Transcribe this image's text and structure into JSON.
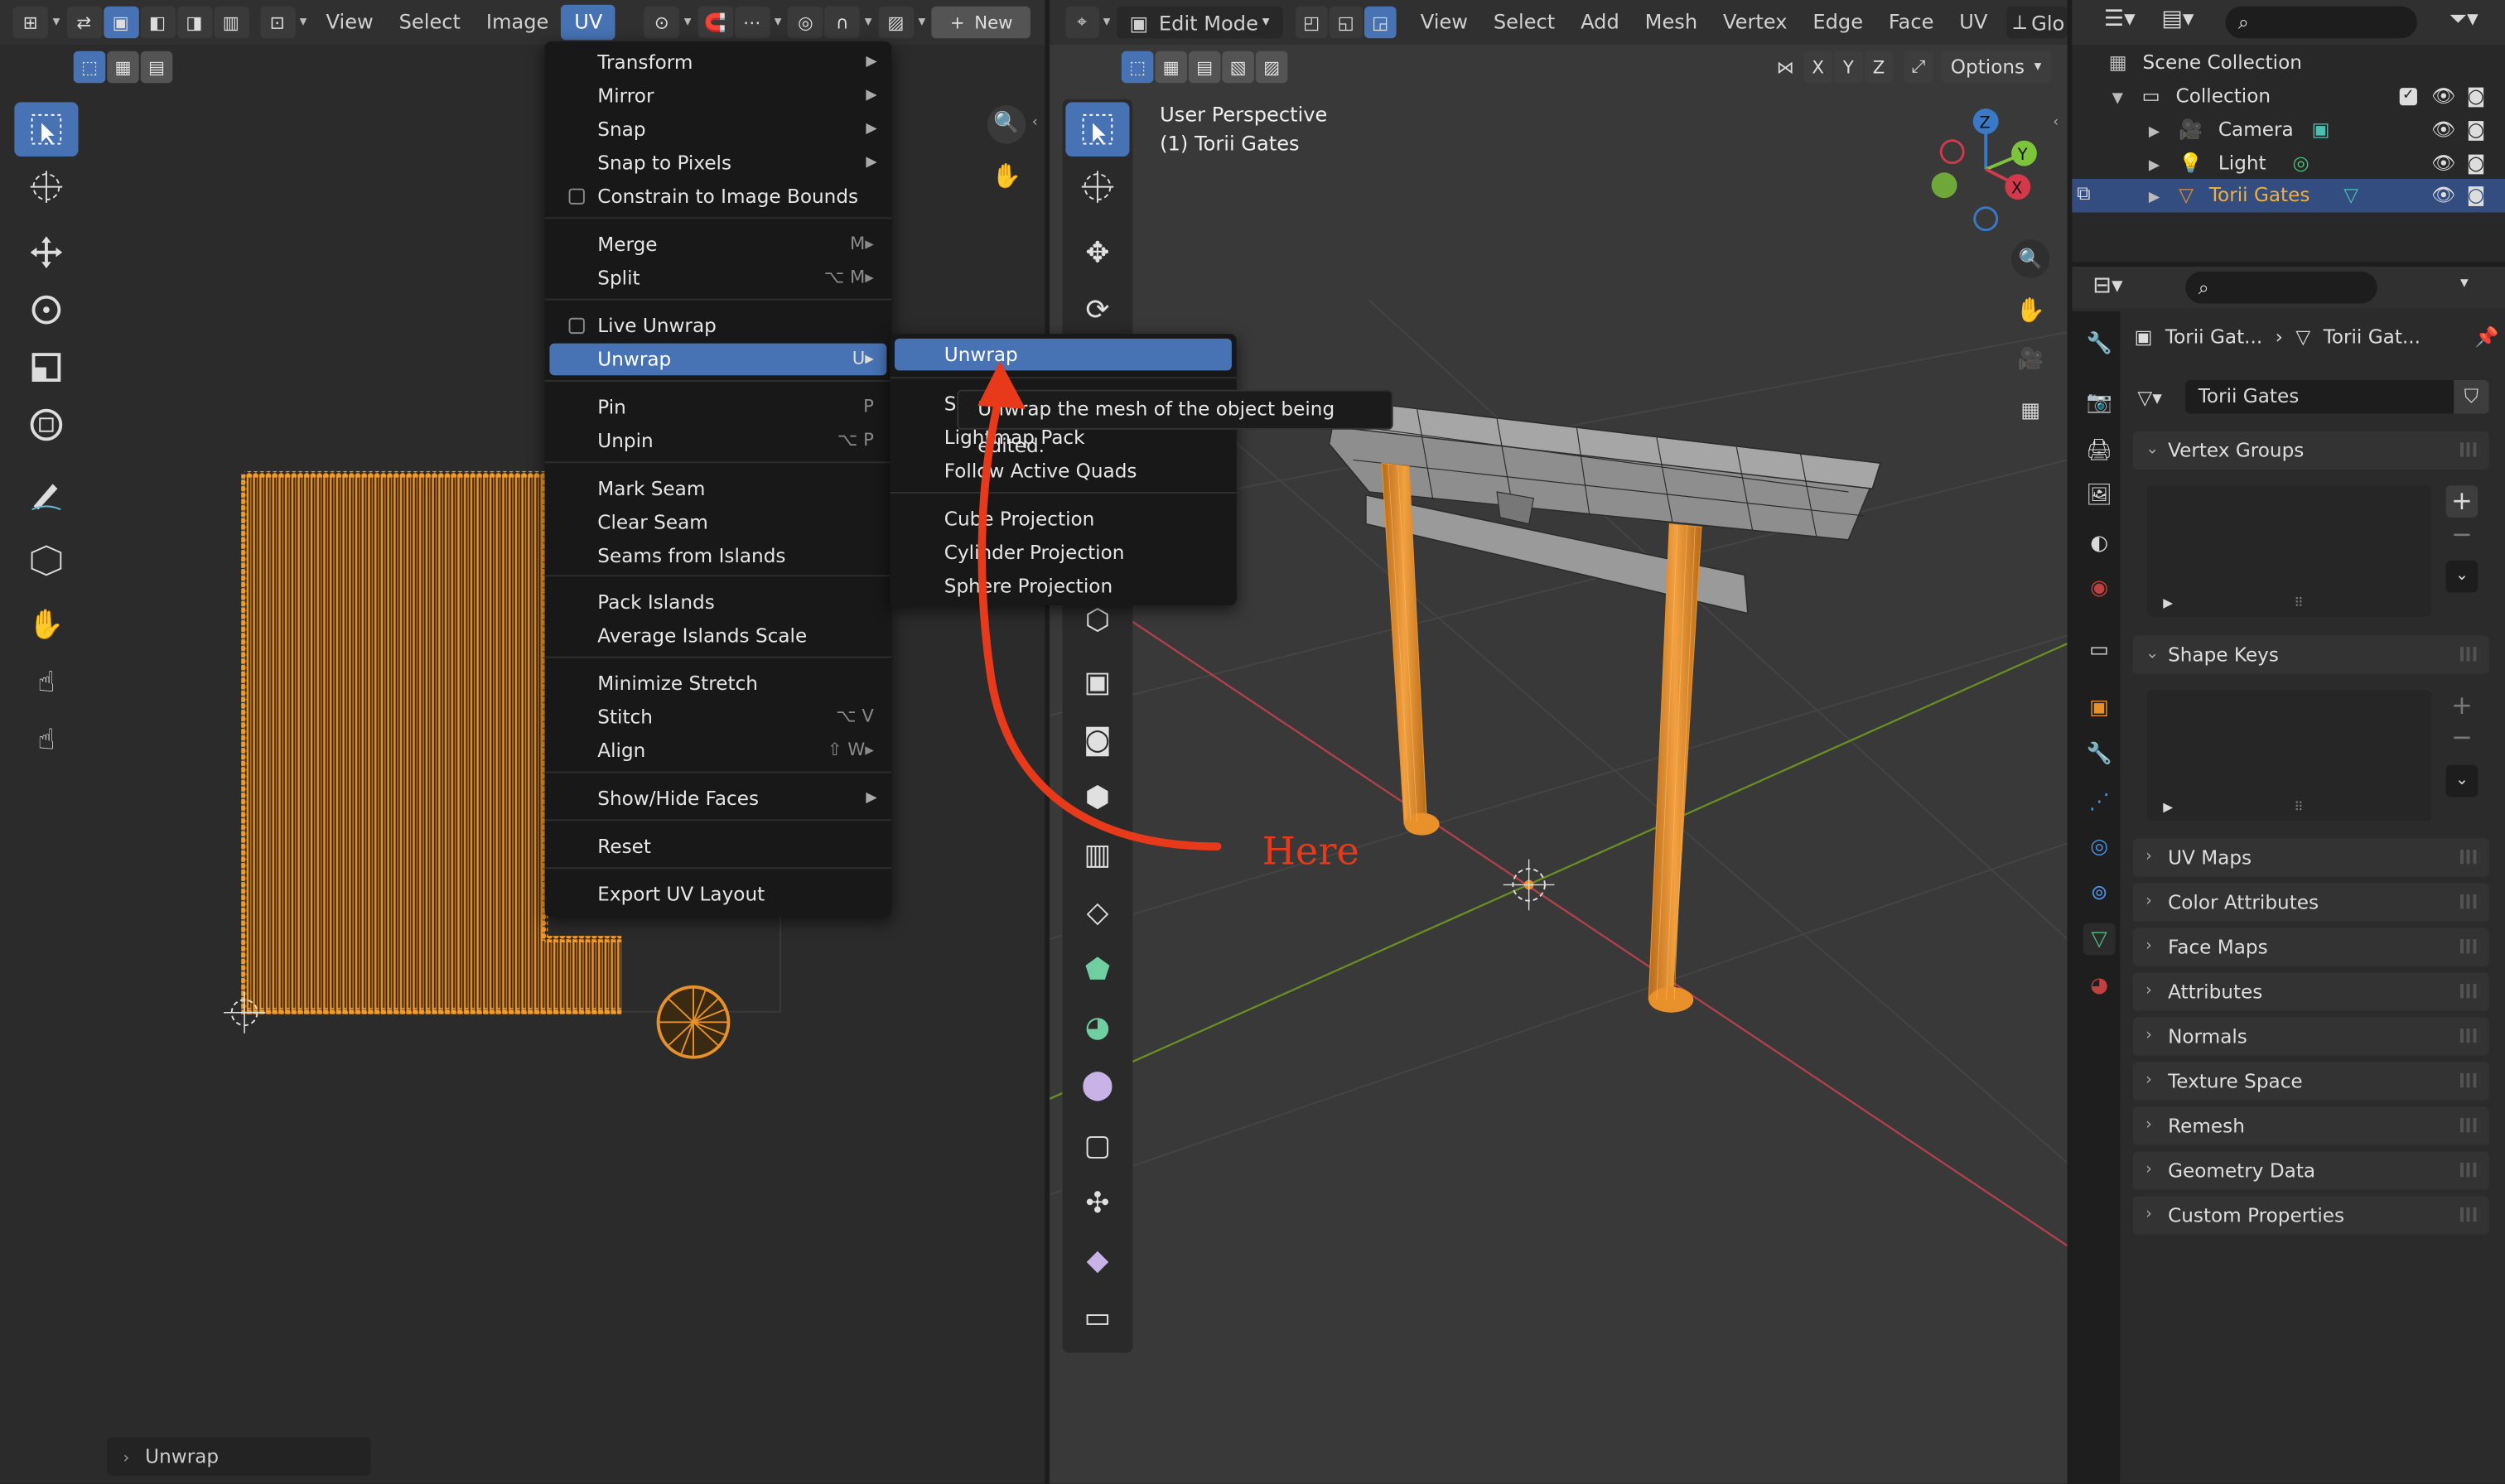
{
  "uv_editor": {
    "menu": [
      "View",
      "Select",
      "Image",
      "UV"
    ],
    "new_label": "New",
    "footer_panel": "Unwrap"
  },
  "uv_menu": {
    "items": [
      {
        "label": "Transform",
        "sub": true
      },
      {
        "label": "Mirror",
        "sub": true
      },
      {
        "label": "Snap",
        "sub": true
      },
      {
        "label": "Snap to Pixels",
        "sub": true
      },
      {
        "label": "Constrain to Image Bounds",
        "checkbox": true
      },
      {
        "label": "Merge",
        "shortcut": "M▸"
      },
      {
        "label": "Split",
        "shortcut": "⌥ M▸"
      },
      {
        "label": "Live Unwrap",
        "checkbox": true
      },
      {
        "label": "Unwrap",
        "shortcut": "U▸"
      },
      {
        "label": "Pin",
        "shortcut": "P"
      },
      {
        "label": "Unpin",
        "shortcut": "⌥ P"
      },
      {
        "label": "Mark Seam"
      },
      {
        "label": "Clear Seam"
      },
      {
        "label": "Seams from Islands"
      },
      {
        "label": "Pack Islands"
      },
      {
        "label": "Average Islands Scale"
      },
      {
        "label": "Minimize Stretch"
      },
      {
        "label": "Stitch",
        "shortcut": "⌥ V"
      },
      {
        "label": "Align",
        "shortcut": "⇧ W▸"
      },
      {
        "label": "Show/Hide Faces",
        "sub": true
      },
      {
        "label": "Reset"
      },
      {
        "label": "Export UV Layout"
      }
    ]
  },
  "unwrap_submenu": {
    "items": [
      "Unwrap",
      "Smart UV Project",
      "Lightmap Pack",
      "Follow Active Quads",
      "Cube Projection",
      "Cylinder Projection",
      "Sphere Projection"
    ],
    "tooltip": "Unwrap the mesh of the object being edited."
  },
  "annotation": {
    "text": "Here",
    "color": "#e83a1a"
  },
  "viewport": {
    "mode": "Edit Mode",
    "menu": [
      "View",
      "Select",
      "Add",
      "Mesh",
      "Vertex",
      "Edge",
      "Face",
      "UV"
    ],
    "menu_cut": "Glo",
    "options_label": "Options",
    "axes": [
      "X",
      "Y",
      "Z"
    ],
    "perspective": "User Perspective",
    "object_label": "(1) Torii Gates",
    "gizmo_labels": {
      "z": "Z",
      "y": "Y",
      "x": "X"
    }
  },
  "outliner": {
    "root": "Scene Collection",
    "collection": "Collection",
    "objects": [
      {
        "label": "Camera",
        "selected": false
      },
      {
        "label": "Light",
        "selected": false
      },
      {
        "label": "Torii Gates",
        "selected": true
      }
    ]
  },
  "properties": {
    "breadcrumb_object": "Torii Gat...",
    "breadcrumb_mesh": "Torii Gat...",
    "mesh_name": "Torii Gates",
    "panels_open": [
      "Vertex Groups",
      "Shape Keys"
    ],
    "panels_closed": [
      "UV Maps",
      "Color Attributes",
      "Face Maps",
      "Attributes",
      "Normals",
      "Texture Space",
      "Remesh",
      "Geometry Data",
      "Custom Properties"
    ]
  },
  "colors": {
    "accent": "#4772b3",
    "orange": "#e8902a",
    "arrow": "#e83a1a"
  }
}
